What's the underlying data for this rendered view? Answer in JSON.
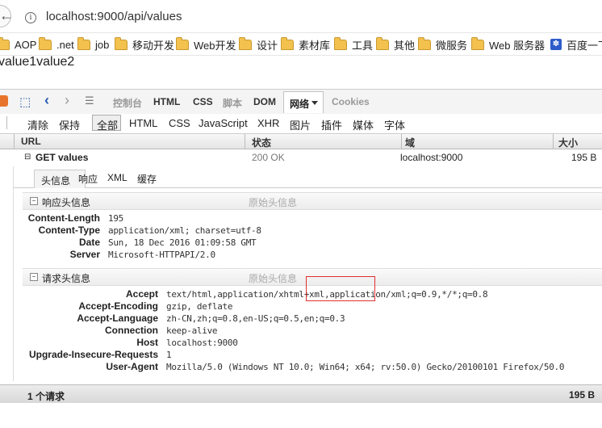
{
  "browser": {
    "url": "localhost:9000/api/values",
    "info_icon": "info-icon",
    "back_icon": "back-arrow-icon",
    "bookmarks": [
      {
        "label": "AOP",
        "icon": "folder-icon"
      },
      {
        "label": ".net",
        "icon": "folder-icon"
      },
      {
        "label": "job",
        "icon": "folder-icon"
      },
      {
        "label": "移动开发",
        "icon": "folder-icon"
      },
      {
        "label": "Web开发",
        "icon": "folder-icon"
      },
      {
        "label": "设计",
        "icon": "folder-icon"
      },
      {
        "label": "素材库",
        "icon": "folder-icon"
      },
      {
        "label": "工具",
        "icon": "folder-icon"
      },
      {
        "label": "其他",
        "icon": "folder-icon"
      },
      {
        "label": "微服务",
        "icon": "folder-icon"
      },
      {
        "label": "Web 服务器",
        "icon": "folder-icon"
      },
      {
        "label": "百度一下",
        "icon": "baidu-paw-icon"
      }
    ]
  },
  "page": {
    "body_text": "value1value2"
  },
  "firebug": {
    "tabs": [
      "控制台",
      "HTML",
      "CSS",
      "脚本",
      "DOM",
      "网络",
      "Cookies"
    ],
    "active_tab": "网络",
    "filters": {
      "clear": "清除",
      "persist": "保持",
      "types": [
        "全部",
        "HTML",
        "CSS",
        "JavaScript",
        "XHR",
        "图片",
        "插件",
        "媒体",
        "字体"
      ],
      "active": "全部"
    },
    "columns": {
      "url": "URL",
      "status": "状态",
      "domain": "域",
      "size": "大小"
    },
    "request": {
      "toggle": "⊟",
      "label": "GET values",
      "status": "200 OK",
      "domain": "localhost:9000",
      "size": "195 B"
    },
    "detail_tabs": [
      "头信息",
      "响应",
      "XML",
      "缓存"
    ],
    "response_section": {
      "title": "响应头信息",
      "raw_link": "原始头信息",
      "headers": [
        {
          "name": "Content-Length",
          "value": "195"
        },
        {
          "name": "Content-Type",
          "value": "application/xml; charset=utf-8"
        },
        {
          "name": "Date",
          "value": "Sun, 18 Dec 2016 01:09:58 GMT"
        },
        {
          "name": "Server",
          "value": "Microsoft-HTTPAPI/2.0"
        }
      ]
    },
    "request_section": {
      "title": "请求头信息",
      "raw_link": "原始头信息",
      "headers": [
        {
          "name": "Accept",
          "value": "text/html,application/xhtml+xml,application/xml;q=0.9,*/*;q=0.8"
        },
        {
          "name": "Accept-Encoding",
          "value": "gzip, deflate"
        },
        {
          "name": "Accept-Language",
          "value": "zh-CN,zh;q=0.8,en-US;q=0.5,en;q=0.3"
        },
        {
          "name": "Connection",
          "value": "keep-alive"
        },
        {
          "name": "Host",
          "value": "localhost:9000"
        },
        {
          "name": "Upgrade-Insecure-Requests",
          "value": "1"
        },
        {
          "name": "User-Agent",
          "value": "Mozilla/5.0 (Windows NT 10.0; Win64; x64; rv:50.0) Gecko/20100101 Firefox/50.0"
        }
      ]
    },
    "status_bar": {
      "requests": "1 个请求",
      "total_size": "195 B"
    },
    "highlight_color": "#e03030"
  }
}
